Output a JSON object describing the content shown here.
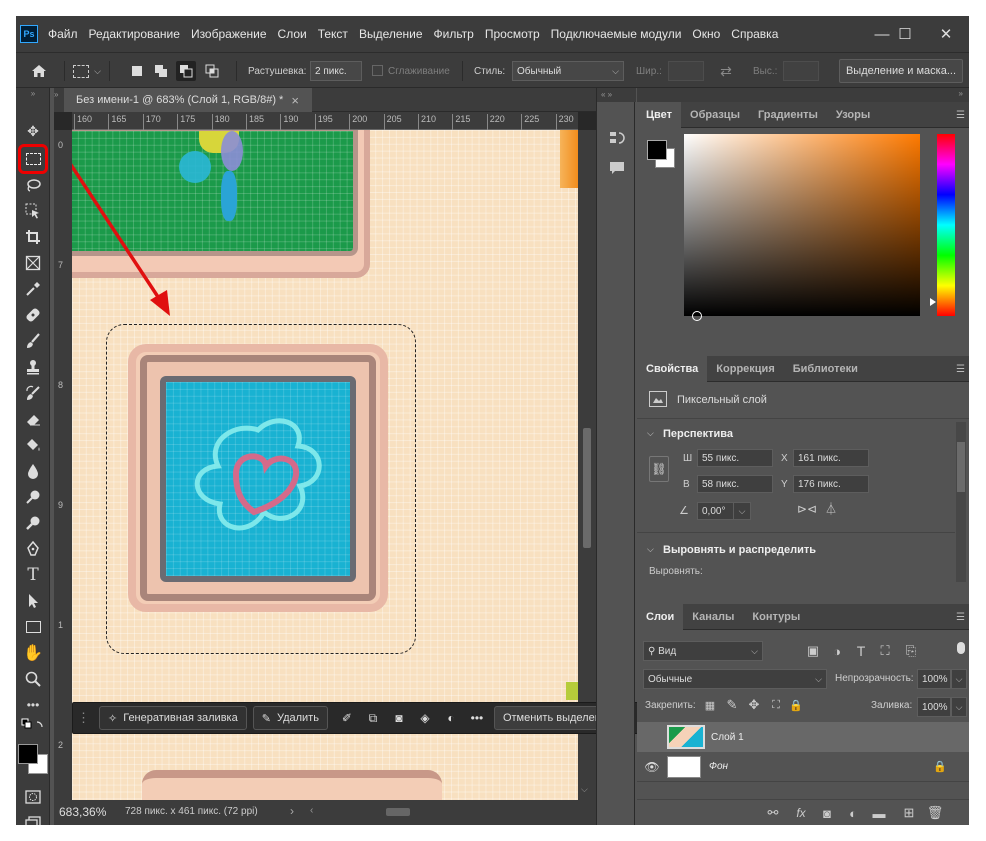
{
  "app": {
    "logo": "Ps"
  },
  "menu": [
    "Файл",
    "Редактирование",
    "Изображение",
    "Слои",
    "Текст",
    "Выделение",
    "Фильтр",
    "Просмотр",
    "Подключаемые модули",
    "Окно",
    "Справка"
  ],
  "window": {
    "minimize": "—",
    "maximize": "☐",
    "close": "✕"
  },
  "options": {
    "feather_label": "Растушевка:",
    "feather_value": "2 пикс.",
    "antialias_label": "Сглаживание",
    "style_label": "Стиль:",
    "style_value": "Обычный",
    "width_label": "Шир.:",
    "height_label": "Выс.:",
    "select_mask_btn": "Выделение и маска..."
  },
  "document": {
    "tab_title": "Без имени-1 @ 683% (Слой 1, RGB/8#) *",
    "tab_close": "×",
    "ruler_marks": [
      "160",
      "165",
      "170",
      "175",
      "180",
      "185",
      "190",
      "195",
      "200",
      "205",
      "210",
      "215",
      "220",
      "225",
      "230"
    ],
    "left_ruler_marks": [
      "0",
      "7",
      "8",
      "9",
      "1",
      "2"
    ],
    "zoom": "683,36%",
    "doc_info": "728 пикс. x 461 пикс. (72 ppi)"
  },
  "context_bar": {
    "generative_fill": "Генеративная заливка",
    "remove": "Удалить",
    "deselect": "Отменить выделение",
    "more": "•••"
  },
  "color_panel": {
    "tabs": [
      "Цвет",
      "Образцы",
      "Градиенты",
      "Узоры"
    ],
    "fg": "#000000",
    "bg": "#ffffff"
  },
  "properties": {
    "tabs": [
      "Свойства",
      "Коррекция",
      "Библиотеки"
    ],
    "layer_type": "Пиксельный слой",
    "transform_title": "Перспектива",
    "w_label": "Ш",
    "w_value": "55 пикс.",
    "h_label": "В",
    "h_value": "58 пикс.",
    "x_label": "X",
    "x_value": "161 пикс.",
    "y_label": "Y",
    "y_value": "176 пикс.",
    "angle_value": "0,00°",
    "align_title": "Выровнять и распределить",
    "align_label": "Выровнять:"
  },
  "layers": {
    "tabs": [
      "Слои",
      "Каналы",
      "Контуры"
    ],
    "filter_kind": "Вид",
    "blend_mode": "Обычные",
    "opacity_label": "Непрозрачность:",
    "opacity_value": "100%",
    "lock_label": "Закрепить:",
    "fill_label": "Заливка:",
    "fill_value": "100%",
    "items": [
      {
        "name": "Слой 1"
      },
      {
        "name": "Фон"
      }
    ]
  }
}
